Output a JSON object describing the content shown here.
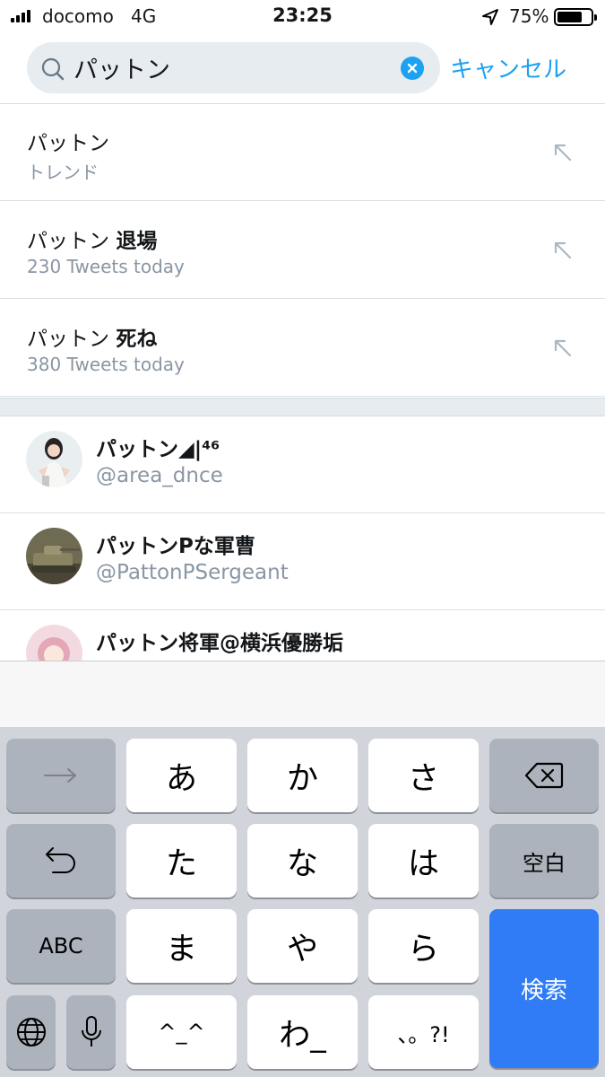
{
  "status_bar": {
    "carrier": "docomo",
    "network": "4G",
    "time": "23:25",
    "battery_percent": "75%",
    "battery_level": 0.75
  },
  "search": {
    "query": "パットン",
    "cancel_label": "キャンセル"
  },
  "trends": [
    {
      "prefix": "パットン",
      "bold": "",
      "meta": "トレンド"
    },
    {
      "prefix": "パットン ",
      "bold": "退場",
      "meta": "230 Tweets today"
    },
    {
      "prefix": "パットン ",
      "bold": "死ね",
      "meta": "380 Tweets today"
    }
  ],
  "users": [
    {
      "name": "パットン◢|⁴⁶",
      "handle": "@area_dnce"
    },
    {
      "name": "パットンPな軍曹",
      "handle": "@PattonPSergeant"
    },
    {
      "name": "パットン将軍@横浜優勝垢",
      "handle": ""
    }
  ],
  "keyboard": {
    "row1": [
      "→",
      "あ",
      "か",
      "さ",
      "⌫"
    ],
    "row2": [
      "↺",
      "た",
      "な",
      "は",
      "空白"
    ],
    "row3": [
      "ABC",
      "ま",
      "や",
      "ら"
    ],
    "row4": [
      "🌐",
      "🎤",
      "^_^",
      "わ_",
      "、。?!"
    ],
    "enter_label": "検索",
    "icons": {
      "next": "arrow-right-icon",
      "delete": "delete-icon",
      "undo": "undo-icon",
      "globe": "globe-icon",
      "mic": "microphone-icon"
    }
  },
  "colors": {
    "accent": "#1da1f2",
    "secondary_text": "#8a96a3",
    "keyboard_bg": "#d1d5db",
    "enter_key": "#2f7cf6"
  }
}
